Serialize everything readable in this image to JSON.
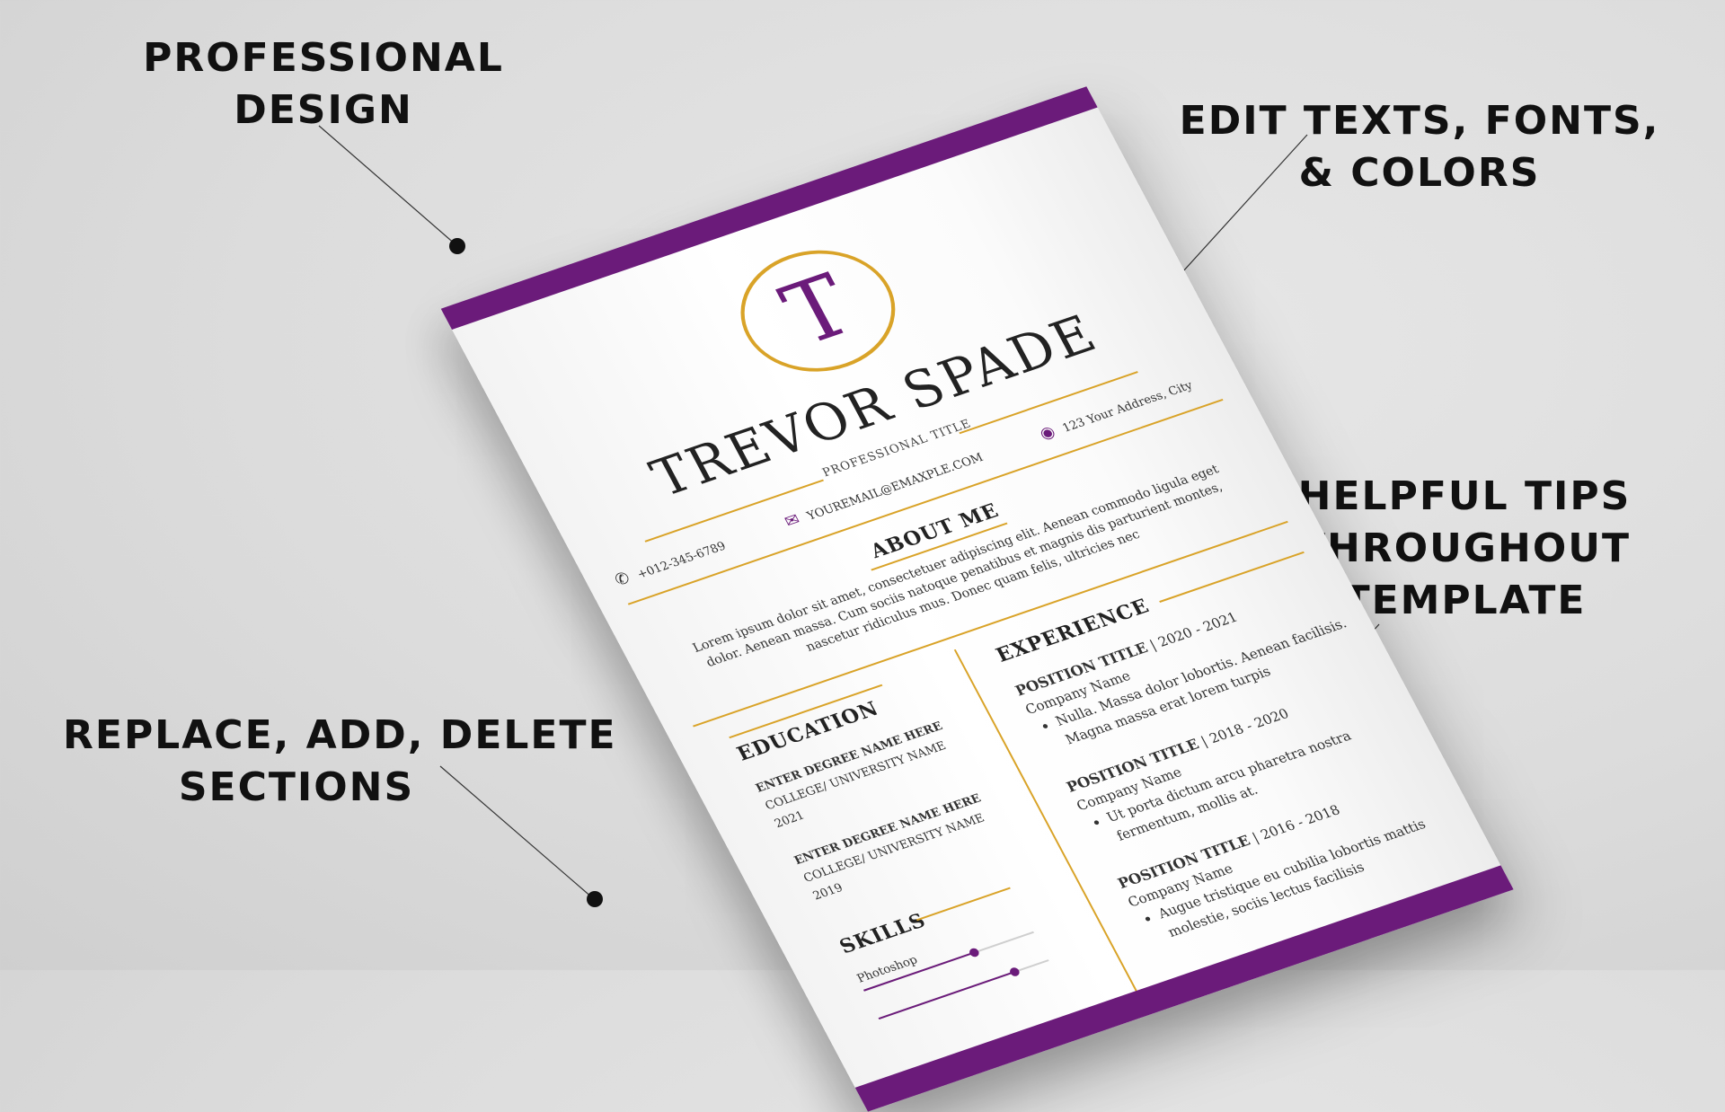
{
  "callouts": {
    "professional_design": [
      "PROFESSIONAL",
      "DESIGN"
    ],
    "edit_texts": [
      "EDIT TEXTS, FONTS,",
      "& COLORS"
    ],
    "helpful_tips": [
      "HELPFUL TIPS",
      "THROUGHOUT",
      "TEMPLATE"
    ],
    "replace_sections": [
      "REPLACE, ADD, DELETE",
      "SECTIONS"
    ]
  },
  "resume": {
    "monogram": "T",
    "name": "TREVOR SPADE",
    "professional_title": "PROFESSIONAL TITLE",
    "phone": "+012-345-6789",
    "email": "YOUREMAIL@EMAXPLE.COM",
    "address": "123 Your Address, City",
    "phone_icon": "phone-icon",
    "email_icon": "mail-icon",
    "address_icon": "map-pin-icon",
    "about_title": "ABOUT ME",
    "about_text": "Lorem ipsum dolor sit amet, consectetuer adipiscing elit. Aenean commodo ligula eget dolor. Aenean massa. Cum sociis natoque penatibus et magnis dis parturient montes, nascetur ridiculus mus. Donec quam felis, ultricies nec",
    "education_title": "EDUCATION",
    "education": [
      {
        "degree": "ENTER DEGREE NAME HERE",
        "school": "COLLEGE/ UNIVERSITY NAME",
        "year": "2021"
      },
      {
        "degree": "ENTER DEGREE NAME HERE",
        "school": "COLLEGE/ UNIVERSITY NAME",
        "year": "2019"
      }
    ],
    "skills_title": "SKILLS",
    "skills": [
      {
        "name": "Photoshop",
        "level": 0.65
      },
      {
        "name": "",
        "level": 0.8
      }
    ],
    "experience_title": "EXPERIENCE",
    "experience": [
      {
        "title": "POSITION TITLE",
        "years": "| 2020 - 2021",
        "company": "Company Name",
        "bullet": "Nulla. Massa dolor lobortis. Aenean facilisis. Magna massa erat lorem turpis"
      },
      {
        "title": "POSITION TITLE",
        "years": "| 2018 - 2020",
        "company": "Company Name",
        "bullet": "Ut porta dictum arcu pharetra nostra fermentum, mollis at."
      },
      {
        "title": "POSITION TITLE",
        "years": "| 2016 - 2018",
        "company": "Company Name",
        "bullet": "Augue tristique eu cubilia lobortis mattis molestie, sociis lectus facilisis"
      }
    ]
  },
  "colors": {
    "accent_purple": "#6b1b7a",
    "accent_gold": "#d9a328"
  }
}
